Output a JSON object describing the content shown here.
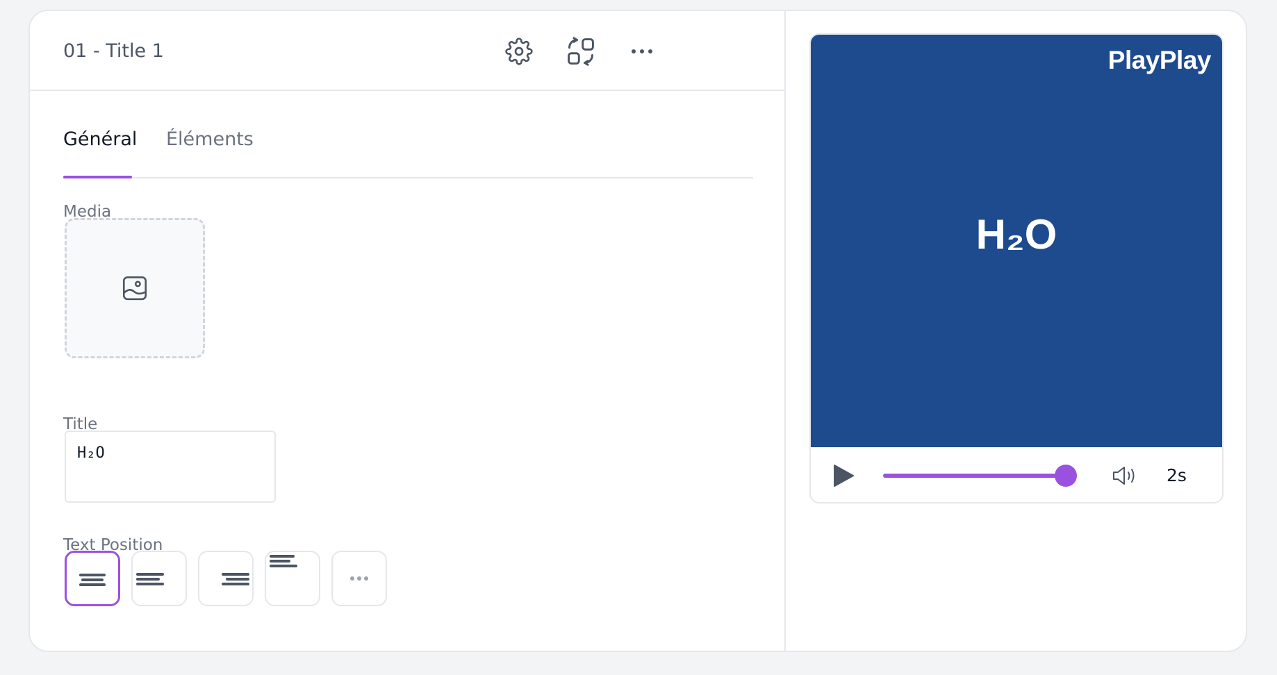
{
  "header": {
    "scene_title": "01 - Title 1",
    "icons": [
      "gear-icon",
      "swap-layout-icon",
      "more-horizontal-icon"
    ]
  },
  "tabs": [
    {
      "label": "Général",
      "active": true
    },
    {
      "label": "Éléments",
      "active": false
    }
  ],
  "media": {
    "label": "Media",
    "icon": "image-placeholder-icon"
  },
  "title_field": {
    "label": "Title",
    "value": "H₂O"
  },
  "text_position": {
    "label": "Text Position",
    "options": [
      "center",
      "left",
      "right",
      "top-left",
      "more"
    ],
    "selected": "center"
  },
  "preview": {
    "brand": "PlayPlay",
    "title": "H₂O",
    "background_color": "#1e4a8e",
    "progress": 1.0,
    "duration": "2s"
  },
  "colors": {
    "accent": "#9b51e0",
    "video_bg": "#1e4a8e"
  }
}
